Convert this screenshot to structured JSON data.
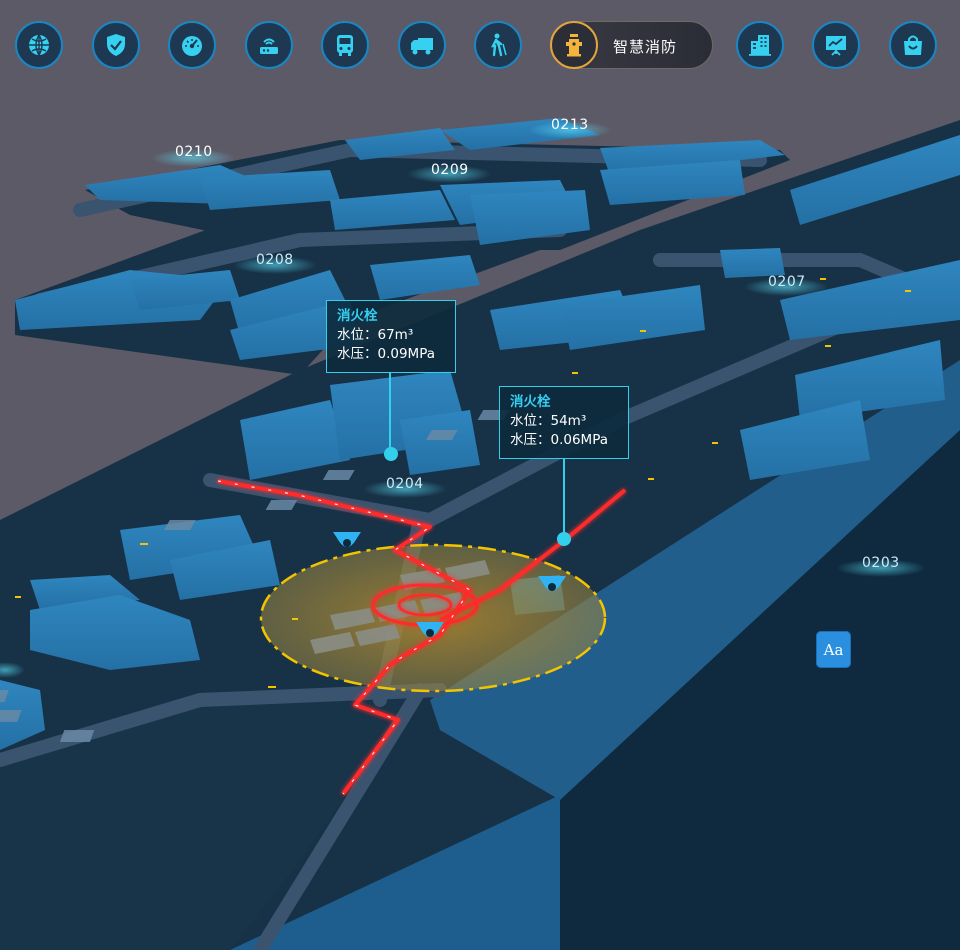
{
  "toolbar": {
    "items": [
      {
        "icon": "globe-icon"
      },
      {
        "icon": "shield-check-icon"
      },
      {
        "icon": "speedometer-icon"
      },
      {
        "icon": "router-icon"
      },
      {
        "icon": "bus-icon"
      },
      {
        "icon": "truck-icon"
      },
      {
        "icon": "pedestrian-icon"
      },
      {
        "icon": "fire-hydrant-icon",
        "label": "智慧消防",
        "active": true
      },
      {
        "icon": "buildings-icon"
      },
      {
        "icon": "presentation-chart-icon"
      },
      {
        "icon": "shopping-bag-icon"
      }
    ],
    "accent": "#1a86c4",
    "active_accent": "#e2a53d"
  },
  "zones": [
    "0210",
    "0213",
    "0209",
    "0208",
    "0207",
    "0204",
    "0203"
  ],
  "hydrant_callouts": [
    {
      "title": "消火栓",
      "level_label": "水位：",
      "level_value": "67m³",
      "pressure_label": "水压：",
      "pressure_value": "0.09MPa"
    },
    {
      "title": "消火栓",
      "level_label": "水位：",
      "level_value": "54m³",
      "pressure_label": "水压：",
      "pressure_value": "0.06MPa"
    }
  ],
  "font_button": {
    "label": "Aa"
  },
  "colors": {
    "background": "#5d5a67",
    "building": "#2a7bb0",
    "ground": "#173247",
    "road": "#35506a",
    "pipe": "#ff2a2a",
    "alert_zone": "#f5c400"
  }
}
